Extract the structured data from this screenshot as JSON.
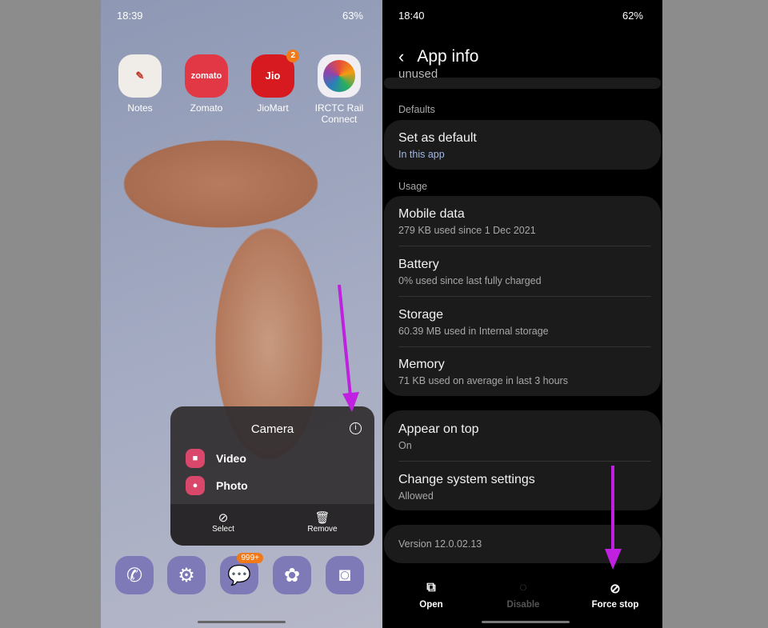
{
  "left": {
    "status": {
      "time": "18:39",
      "battery": "63%"
    },
    "apps": [
      {
        "label": "Notes",
        "color": "#f0ece8"
      },
      {
        "label": "Zomato",
        "color": "#e23744",
        "icon_text": "zomato"
      },
      {
        "label": "JioMart",
        "color": "#d71920",
        "icon_text": "Jio",
        "badge": "2"
      },
      {
        "label": "IRCTC Rail Connect",
        "color": "#f0eef2"
      }
    ],
    "popup": {
      "title": "Camera",
      "items": [
        "Video",
        "Photo"
      ],
      "actions": [
        "Select",
        "Remove"
      ]
    },
    "dock": {
      "messages_badge": "999+"
    }
  },
  "right": {
    "status": {
      "time": "18:40",
      "battery": "62%"
    },
    "header": {
      "title": "App info"
    },
    "partial_text": "unused",
    "sections": {
      "defaults": "Defaults",
      "usage": "Usage"
    },
    "rows": [
      {
        "title": "Set as default",
        "sub": "In this app"
      },
      {
        "title": "Mobile data",
        "sub": "279 KB used since 1 Dec 2021"
      },
      {
        "title": "Battery",
        "sub": "0% used since last fully charged"
      },
      {
        "title": "Storage",
        "sub": "60.39 MB used in Internal storage"
      },
      {
        "title": "Memory",
        "sub": "71 KB used on average in last 3 hours"
      },
      {
        "title": "Appear on top",
        "sub": "On"
      },
      {
        "title": "Change system settings",
        "sub": "Allowed"
      }
    ],
    "version": "Version 12.0.02.13",
    "bottom": [
      "Open",
      "Disable",
      "Force stop"
    ]
  },
  "colors": {
    "arrow": "#c020e0",
    "accent_sub": "#a3b8e6",
    "dock": "#7e7ab8"
  }
}
